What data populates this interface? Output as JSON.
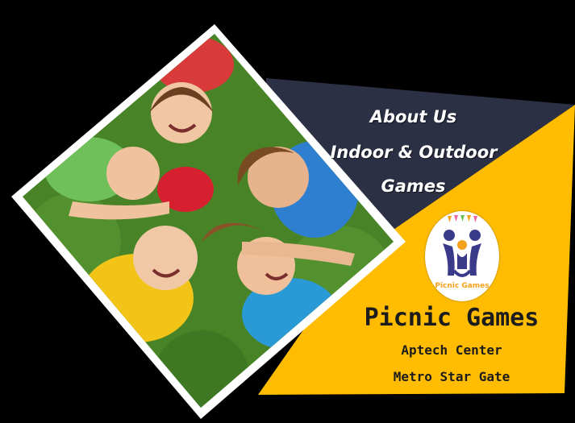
{
  "menu": {
    "about_label": "About Us",
    "games_line_1": "Indoor & Outdoor",
    "games_line_2": "Games"
  },
  "logo": {
    "caption": "Picnic Games"
  },
  "brand": {
    "name": "Picnic Games",
    "address_line_1": "Aptech Center",
    "address_line_2": "Metro Star Gate"
  },
  "colors": {
    "background": "#000000",
    "navy_panel": "#2b3044",
    "yellow_panel": "#ffbc00",
    "frame": "#ffffff",
    "grass": "#4f8a2b",
    "brand_text": "#1c1c1c",
    "logo_accent": "#f4a21b",
    "logo_figure": "#3a3a8a"
  }
}
